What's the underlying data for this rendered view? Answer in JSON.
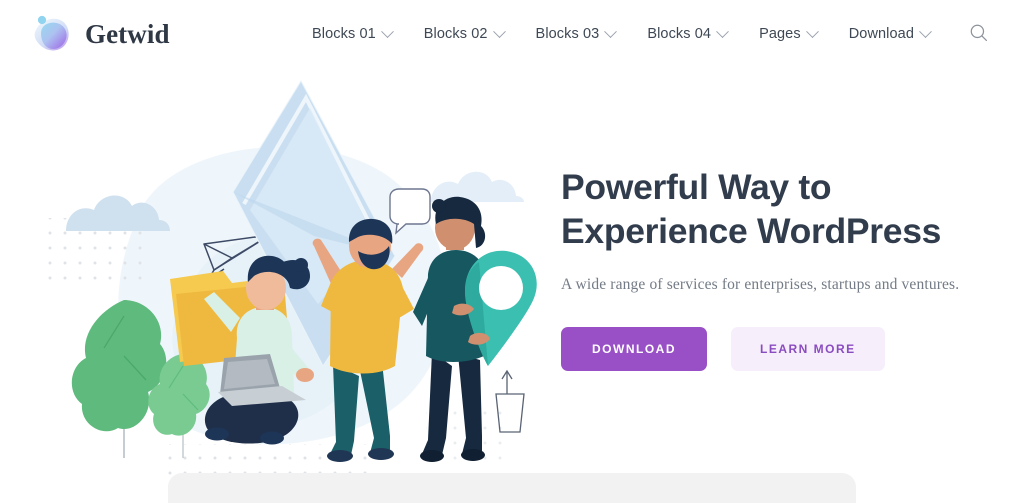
{
  "brand": {
    "name": "Getwid",
    "logo_icon": "getwid-blob-logo",
    "gradient_from": "#7fd3ec",
    "gradient_to": "#9b5de5"
  },
  "header": {
    "nav": [
      {
        "label": "Blocks 01",
        "has_dropdown": true
      },
      {
        "label": "Blocks 02",
        "has_dropdown": true
      },
      {
        "label": "Blocks 03",
        "has_dropdown": true
      },
      {
        "label": "Blocks 04",
        "has_dropdown": true
      },
      {
        "label": "Pages",
        "has_dropdown": true
      },
      {
        "label": "Download",
        "has_dropdown": true
      }
    ],
    "search_icon": "search-icon"
  },
  "hero": {
    "title_line1": "Powerful Way to",
    "title_line2": "Experience WordPress",
    "subtitle": "A wide range of services for enterprises, startups and ventures.",
    "primary_button": "DOWNLOAD",
    "secondary_button": "LEARN MORE",
    "illustration_name": "team-collaboration-illustration"
  },
  "colors": {
    "accent_purple": "#9950c6",
    "accent_purple_soft": "#f6eefb",
    "heading": "#313c4c",
    "body_text": "#737b86",
    "nav_text": "#3e4854",
    "illustration_yellow": "#efb93f",
    "illustration_teal": "#3bbfb0",
    "illustration_dark_teal": "#14575f",
    "illustration_navy": "#1d3557",
    "illustration_green": "#5fba7d",
    "illustration_envelope": "#cfe1f2",
    "illustration_mint": "#d6f0ea",
    "page_background": "#ffffff",
    "next_section_background": "#f2f2f3"
  }
}
